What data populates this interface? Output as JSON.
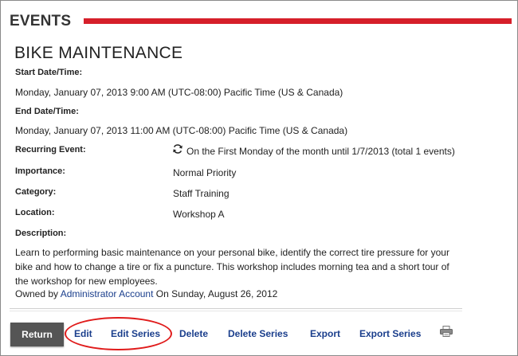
{
  "header": {
    "title": "EVENTS",
    "accent_color": "#d61f2a"
  },
  "event": {
    "title": "BIKE MAINTENANCE",
    "start_label": "Start Date/Time:",
    "start_value": "Monday, January 07, 2013 9:00 AM (UTC-08:00) Pacific Time (US & Canada)",
    "end_label": "End Date/Time:",
    "end_value": "Monday, January 07, 2013 11:00 AM (UTC-08:00) Pacific Time (US & Canada)",
    "recurring_label": "Recurring Event:",
    "recurring_value": "On the First Monday of the month until 1/7/2013 (total 1 events)",
    "importance_label": "Importance:",
    "importance_value": "Normal Priority",
    "category_label": "Category:",
    "category_value": "Staff Training",
    "location_label": "Location:",
    "location_value": "Workshop A",
    "description_label": "Description:",
    "description": "Learn to performing basic maintenance on your personal bike, identify the correct tire pressure for your bike and how to change a tire or fix a puncture. This workshop includes morning tea and a short tour of the workshop for new employees.",
    "owned_prefix": "Owned by",
    "owner": "Administrator Account",
    "owned_suffix": "On Sunday, August 26, 2012"
  },
  "actions": {
    "return": "Return",
    "edit": "Edit",
    "edit_series": "Edit Series",
    "delete": "Delete",
    "delete_series": "Delete Series",
    "export": "Export",
    "export_series": "Export Series",
    "print_icon": "print-icon",
    "highlight_color": "#e01b1b"
  }
}
